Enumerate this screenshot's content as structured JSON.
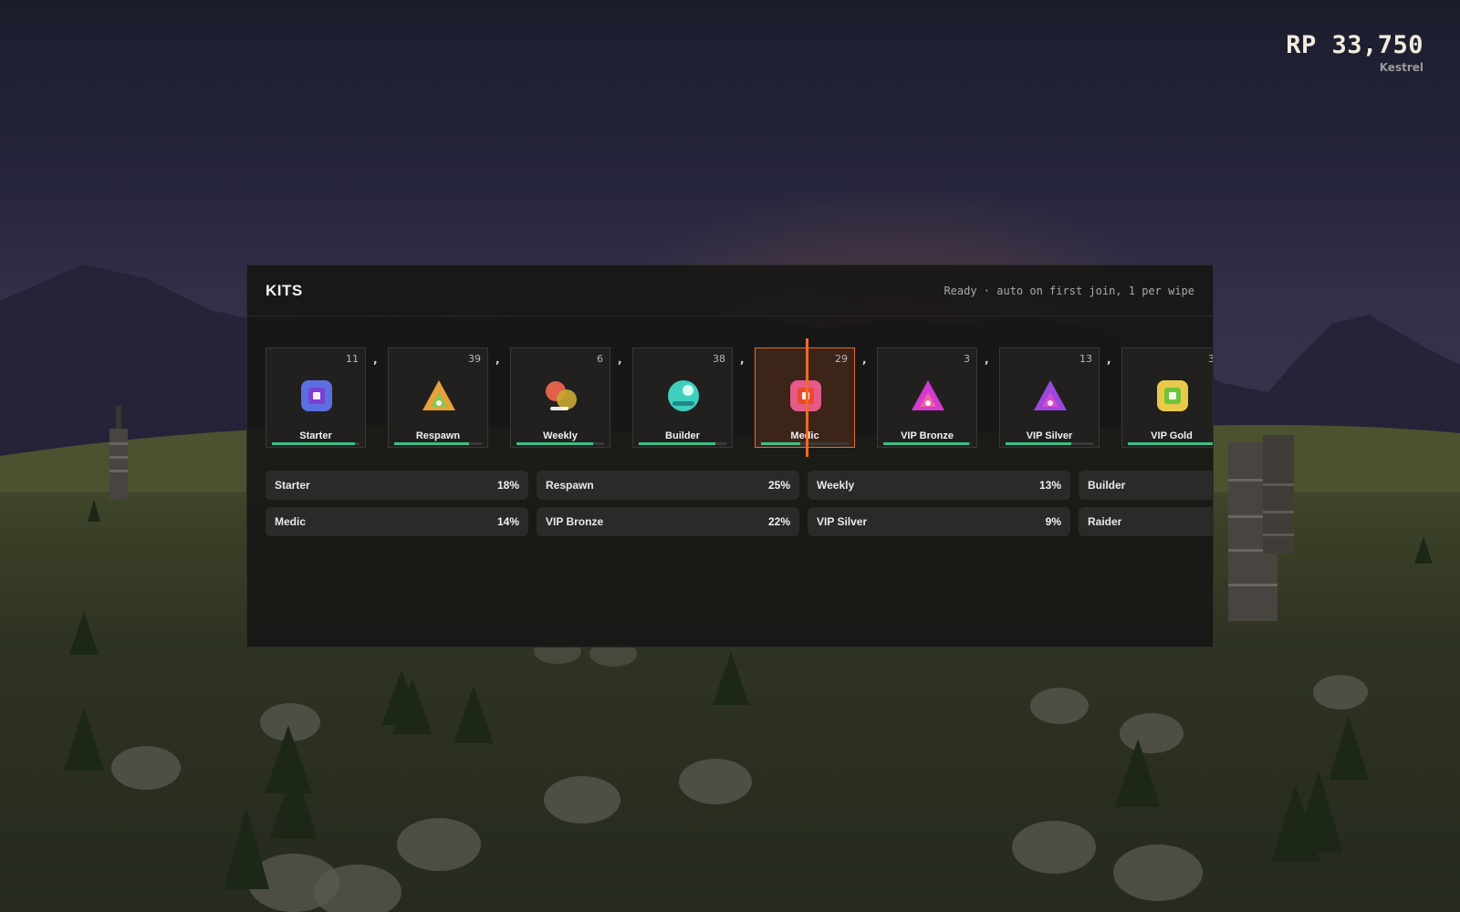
{
  "hud": {
    "currency": "RP 33,750",
    "username": "Kestrel"
  },
  "panel": {
    "title": "KITS",
    "status": "Ready · auto on first join, 1 per wipe"
  },
  "kits": [
    {
      "name": "Starter",
      "count": "11",
      "progress": 0.95,
      "icon": "square-kit-icon",
      "color": "#5b6fe0",
      "inner": "#7b3fd0",
      "selected": false
    },
    {
      "name": "Respawn",
      "count": "39",
      "progress": 0.85,
      "icon": "triangle-kit-icon",
      "color": "#e9a23b",
      "inner": "#7acb58",
      "selected": false
    },
    {
      "name": "Weekly",
      "count": "6",
      "progress": 0.88,
      "icon": "circles-kit-icon",
      "color": "#e0604a",
      "inner": "#c9a830",
      "selected": false
    },
    {
      "name": "Builder",
      "count": "38",
      "progress": 0.87,
      "icon": "orb-kit-icon",
      "color": "#3fd0bc",
      "inner": "#1f8a8a",
      "selected": false
    },
    {
      "name": "Medic",
      "count": "29",
      "progress": 0.45,
      "icon": "square-kit-icon",
      "color": "#e65a8a",
      "inner": "#e84a2a",
      "selected": true
    },
    {
      "name": "VIP Bronze",
      "count": "3",
      "progress": 0.98,
      "icon": "triangle-kit-icon",
      "color": "#d33ad0",
      "inner": "#f36a9a",
      "selected": false
    },
    {
      "name": "VIP Silver",
      "count": "13",
      "progress": 0.75,
      "icon": "triangle-kit-icon",
      "color": "#9b48e0",
      "inner": "#e64ac8",
      "selected": false
    },
    {
      "name": "VIP Gold",
      "count": "3",
      "progress": 1.0,
      "icon": "square-kit-icon",
      "color": "#e9c94a",
      "inner": "#6fc33a",
      "selected": false
    }
  ],
  "separator": ",",
  "stats": [
    {
      "label": "Starter",
      "value": "18%"
    },
    {
      "label": "Respawn",
      "value": "25%"
    },
    {
      "label": "Weekly",
      "value": "13%"
    },
    {
      "label": "Builder",
      "value": ""
    },
    {
      "label": "Medic",
      "value": "14%"
    },
    {
      "label": "VIP Bronze",
      "value": "22%"
    },
    {
      "label": "VIP Silver",
      "value": "9%"
    },
    {
      "label": "Raider",
      "value": ""
    }
  ]
}
